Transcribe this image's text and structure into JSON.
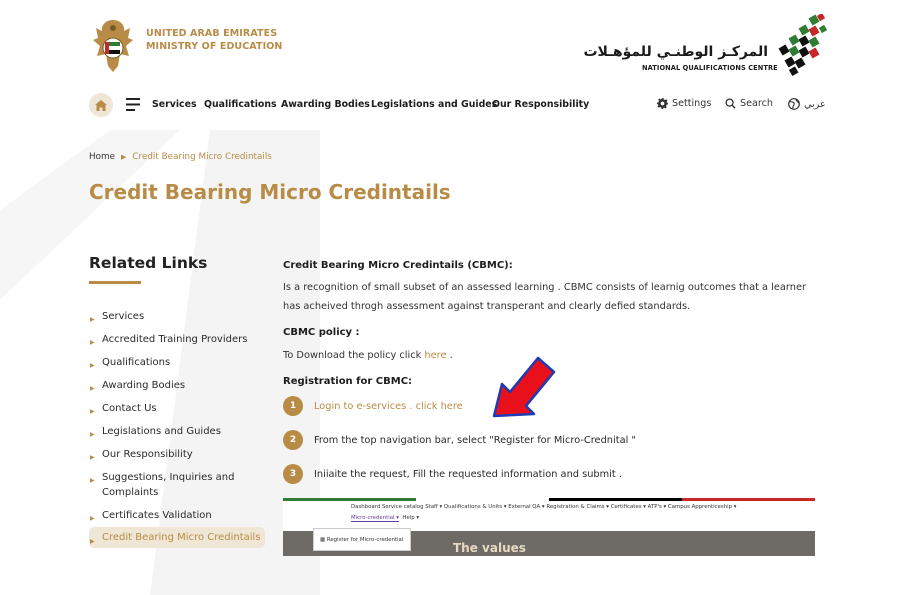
{
  "header": {
    "ministry_line1": "UNITED ARAB EMIRATES",
    "ministry_line2": "MINISTRY OF EDUCATION",
    "nqc_arabic": "المركـز الوطنـي للمؤهـلات",
    "nqc_english": "NATIONAL QUALIFICATIONS CENTRE"
  },
  "nav": {
    "items": [
      "Services",
      "Qualifications",
      "Awarding Bodies",
      "Legislations and Guides",
      "Our Responsibility"
    ],
    "settings": "Settings",
    "search": "Search",
    "language": "عربي"
  },
  "breadcrumb": {
    "home": "Home",
    "current": "Credit Bearing Micro Credintails"
  },
  "page_title": "Credit Bearing Micro Credintails",
  "sidebar": {
    "heading": "Related Links",
    "items": [
      {
        "label": "Services"
      },
      {
        "label": "Accredited Training Providers"
      },
      {
        "label": "Qualifications"
      },
      {
        "label": "Awarding Bodies"
      },
      {
        "label": "Contact Us"
      },
      {
        "label": "Legislations and Guides"
      },
      {
        "label": "Our Responsibility"
      },
      {
        "label": "Suggestions, Inquiries and Complaints"
      },
      {
        "label": "Certificates Validation"
      },
      {
        "label": "Credit Bearing Micro Credintails",
        "active": true
      }
    ]
  },
  "main": {
    "def_heading": "Credit Bearing Micro Credintails (CBMC):",
    "def_text": "Is a recognition of small subset of an assessed learning . CBMC consists of learnig outcomes that a learner has acheived throgh assessment against transperant and clearly defied standards.",
    "policy_heading": "CBMC policy :",
    "policy_text": "To Download the policy click ",
    "policy_link": "here",
    "policy_end": " .",
    "reg_heading": "Registration for CBMC:",
    "steps": [
      {
        "num": "1",
        "text": "Login to e-services . click here",
        "is_link": true
      },
      {
        "num": "2",
        "text": "From the top navigation bar, select \"Register for Micro-Crednital \"",
        "is_link": false
      },
      {
        "num": "3",
        "text": "Iniiaite the request, Fill the requested information and submit .",
        "is_link": false
      }
    ]
  },
  "embedded_screenshot": {
    "menu_row1": "Dashboard   Service catalog   Staff ▾   Qualifications & Units ▾   External QA ▾   Registration & Claims ▾   Certificates ▾   ATP's ▾   Campus   Apprenticeship ▾",
    "menu_micro": "Micro-credential ▾",
    "menu_help": "Help ▾",
    "dropdown_item": "Register for Micro-credential",
    "banner_text": "The values"
  },
  "colors": {
    "accent": "#b88c47",
    "accent_light": "#efe6d5",
    "arrow": "#e8111b",
    "arrow_outline": "#1f3bb3"
  },
  "icons": [
    "home-icon",
    "menu-icon",
    "gear-icon",
    "search-icon",
    "globe-icon",
    "chevron-right-icon"
  ]
}
